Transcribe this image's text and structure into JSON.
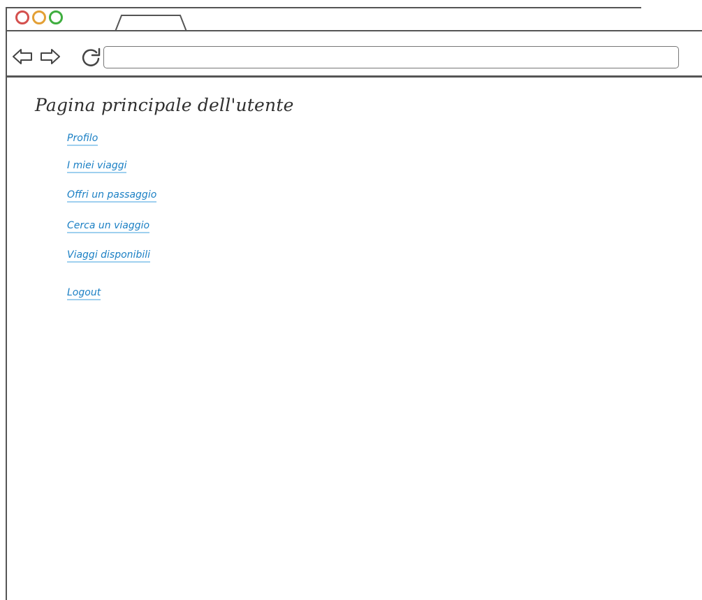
{
  "browser": {
    "window_controls": [
      "close",
      "minimize",
      "maximize"
    ],
    "tab": {
      "label": ""
    },
    "toolbar": {
      "back_icon": "back-arrow-icon",
      "forward_icon": "forward-arrow-icon",
      "reload_icon": "reload-icon",
      "address": ""
    }
  },
  "page": {
    "title": "Pagina principale dell'utente",
    "links": [
      {
        "label": "Profilo"
      },
      {
        "label": "I miei viaggi"
      },
      {
        "label": "Offri un passaggio"
      },
      {
        "label": "Cerca un viaggio"
      },
      {
        "label": "Viaggi disponibili"
      },
      {
        "label": "Logout"
      }
    ]
  },
  "colors": {
    "link": "#1a7fc4",
    "link_underline": "#9fd0ef",
    "title": "#2f2f2f",
    "close_dot": "#d4504e",
    "minimize_dot": "#e3a035",
    "maximize_dot": "#3fae3f"
  }
}
